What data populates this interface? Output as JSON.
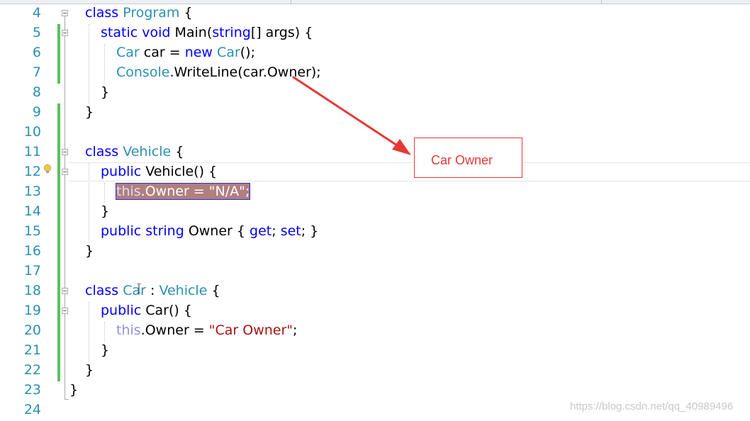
{
  "top_bar": {
    "left_text": "...",
    "middle_text": "...",
    "right_text": "..."
  },
  "line_numbers": [
    "4",
    "5",
    "6",
    "7",
    "8",
    "9",
    "10",
    "11",
    "12",
    "13",
    "14",
    "15",
    "16",
    "17",
    "18",
    "19",
    "20",
    "21",
    "22",
    "23",
    "24"
  ],
  "code": {
    "l4": [
      "class",
      "Program",
      "{"
    ],
    "l5": [
      "static",
      "void",
      "Main(",
      "string",
      "[] args) {"
    ],
    "l6": [
      "Car",
      "car =",
      "new",
      "Car",
      "();"
    ],
    "l7": [
      "Console",
      ".WriteLine(car.Owner);"
    ],
    "l8": [
      "}"
    ],
    "l9": [
      "}"
    ],
    "l11": [
      "class",
      "Vehicle",
      "{"
    ],
    "l12": [
      "public",
      "Vehicle() {"
    ],
    "l13": [
      "this",
      ".Owner = \"N/A\";"
    ],
    "l14": [
      "}"
    ],
    "l15": [
      "public",
      "string",
      "Owner {",
      "get",
      ";",
      "set",
      "; }"
    ],
    "l16": [
      "}"
    ],
    "l18": [
      "class",
      "Car",
      ":",
      "Vehicle",
      "{"
    ],
    "l19": [
      "public",
      "Car() {"
    ],
    "l20": [
      "this",
      ".Owner =",
      "\"Car Owner\"",
      ";"
    ],
    "l21": [
      "}"
    ],
    "l22": [
      "}"
    ],
    "l23": [
      "}"
    ]
  },
  "callout": {
    "text": "Car Owner",
    "color": "#e53935"
  },
  "watermark": "https://blog.csdn.net/qq_40989496",
  "colors": {
    "keyword": "#0000ff",
    "type": "#2b91af",
    "string": "#a31515",
    "line_number": "#2b91af",
    "change_bar": "#57c15c",
    "selection": "#b07f7f"
  },
  "icons": [
    "lightbulb-icon",
    "collapse-icon"
  ]
}
